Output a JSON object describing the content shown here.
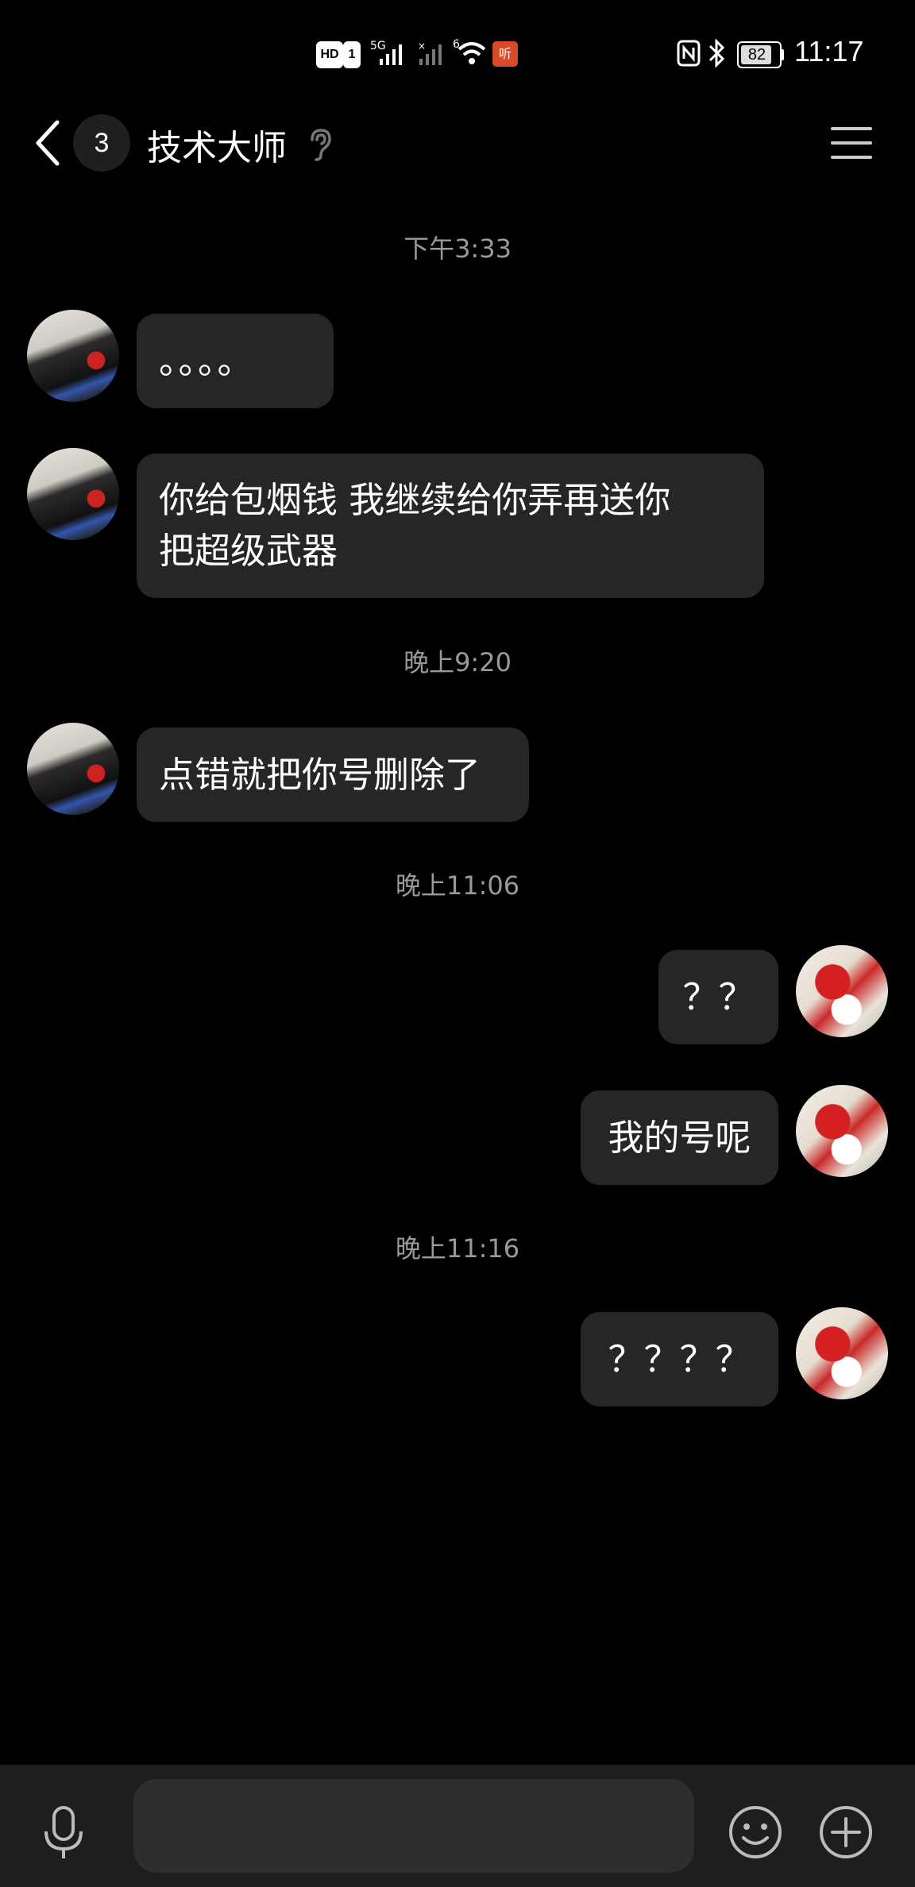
{
  "status_bar": {
    "hd_label": "HD",
    "sim_label": "1",
    "network_5g": "5G",
    "network_6": "6",
    "app_badge": "听",
    "battery_level": "82",
    "clock": "11:17"
  },
  "header": {
    "unread_count": "3",
    "title": "技术大师"
  },
  "messages": [
    {
      "type": "time",
      "text": "下午3:33"
    },
    {
      "type": "received",
      "text": "。。。。"
    },
    {
      "type": "received",
      "line1": "你给包烟钱 我继续给你弄再送你",
      "line2": "把超级武器"
    },
    {
      "type": "time",
      "text": "晚上9:20"
    },
    {
      "type": "received",
      "text": "点错就把你号删除了"
    },
    {
      "type": "time",
      "text": "晚上11:06"
    },
    {
      "type": "sent",
      "text": "？？"
    },
    {
      "type": "sent",
      "text": "我的号呢"
    },
    {
      "type": "time",
      "text": "晚上11:16"
    },
    {
      "type": "sent",
      "text": "？？？？"
    }
  ],
  "input_bar": {
    "input_value": "",
    "placeholder": ""
  },
  "icons": {
    "back": "chevron-left-icon",
    "ear": "ear-icon",
    "menu": "menu-icon",
    "voice": "microphone-icon",
    "emoji": "smiley-icon",
    "more": "plus-circle-icon"
  },
  "colors": {
    "background": "#000000",
    "bubble": "#262626",
    "input_bar": "#1e1e1e",
    "timestamp": "#9a9a9a",
    "status_app": "#d84a2a"
  }
}
